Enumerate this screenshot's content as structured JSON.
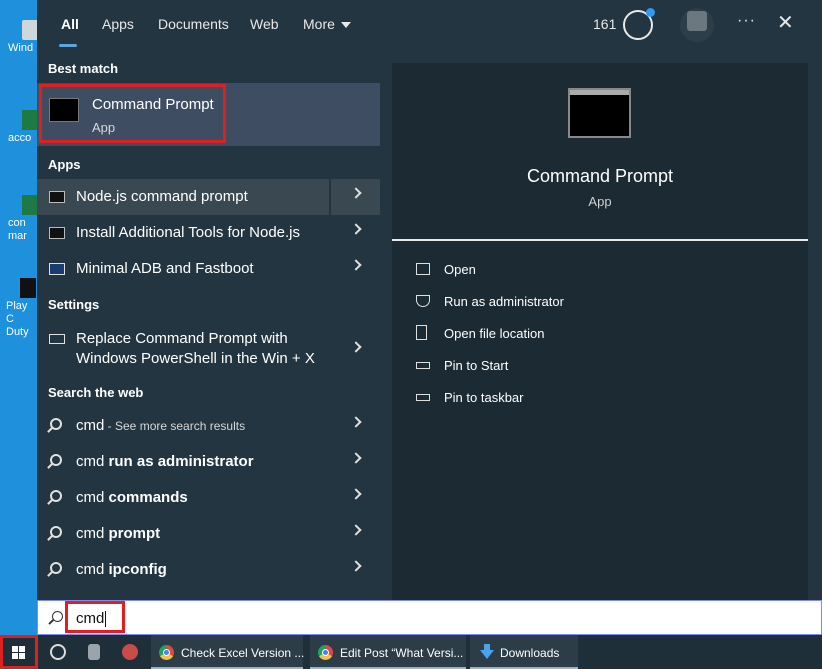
{
  "desktop": {
    "icons": [
      {
        "label": "Wind",
        "color": "#cccccc"
      },
      {
        "label": "acco",
        "color": "#1d7a45"
      },
      {
        "label": "con mar",
        "color": "#1d7a45"
      },
      {
        "label": "Play C Duty",
        "color": "#111111"
      }
    ]
  },
  "tabs": {
    "items": [
      "All",
      "Apps",
      "Documents",
      "Web",
      "More"
    ],
    "active": "All",
    "score": "161"
  },
  "left": {
    "best_match_heading": "Best match",
    "best_match": {
      "title": "Command Prompt",
      "subtitle": "App"
    },
    "apps_heading": "Apps",
    "apps": [
      {
        "label": "Node.js command prompt"
      },
      {
        "label": "Install Additional Tools for Node.js"
      },
      {
        "label": "Minimal ADB and Fastboot"
      }
    ],
    "settings_heading": "Settings",
    "settings": [
      {
        "line1": "Replace Command Prompt with",
        "line2": "Windows PowerShell in the Win + X"
      }
    ],
    "web_heading": "Search the web",
    "web": [
      {
        "query": "cmd",
        "rest": " - See more search results",
        "rest_style": "sub"
      },
      {
        "query": "cmd ",
        "rest": "run as administrator",
        "rest_style": "bold"
      },
      {
        "query": "cmd ",
        "rest": "commands",
        "rest_style": "bold"
      },
      {
        "query": "cmd ",
        "rest": "prompt",
        "rest_style": "bold"
      },
      {
        "query": "cmd ",
        "rest": "ipconfig",
        "rest_style": "bold"
      }
    ]
  },
  "preview": {
    "title": "Command Prompt",
    "subtitle": "App",
    "actions": [
      "Open",
      "Run as administrator",
      "Open file location",
      "Pin to Start",
      "Pin to taskbar"
    ]
  },
  "search": {
    "value": "cmd"
  },
  "taskbar": {
    "apps": [
      {
        "label": "Check Excel Version ...",
        "icon": "chrome-icon"
      },
      {
        "label": "Edit Post “What Versi...",
        "icon": "chrome-icon"
      },
      {
        "label": "Downloads",
        "icon": "download-icon"
      }
    ]
  }
}
